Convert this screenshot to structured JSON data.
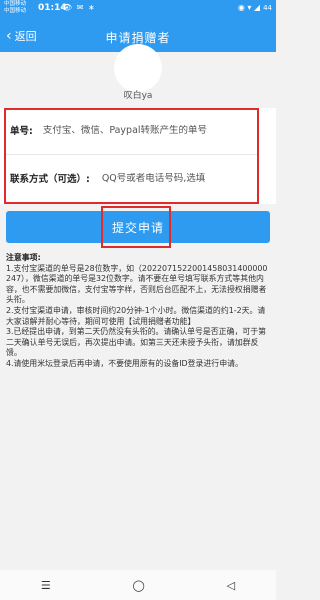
{
  "status_bar": {
    "carrier_1": "中国移动",
    "carrier_2": "中国移动",
    "time": "01:14",
    "icons_left": "👁 ✉ ∗",
    "icons_right": "◉ ▾ ◢",
    "battery": "44"
  },
  "header": {
    "back_label": "返回",
    "title": "申请捐赠者"
  },
  "user": {
    "name": "叹白ya"
  },
  "form": {
    "order_label": "单号:",
    "order_placeholder": "支付宝、微信、Paypal转账产生的单号",
    "contact_label": "联系方式（可选）:",
    "contact_placeholder": "QQ号或者电话号码,选填"
  },
  "submit_label": "提交申请",
  "notes": {
    "title": "注意事项:",
    "items": [
      "1.支付宝渠道的单号是28位数字，如（2022071522001458031400000247），微信渠道的单号是32位数字。请不要在单号填写联系方式等其他内容，也不需要加微信，支付宝等字样，否则后台匹配不上，无法授权捐赠者头衔。",
      "2.支付宝渠道申请，审核时间约20分钟-1个小时。微信渠道的约1-2天。请大家谅解并耐心等待，期间可使用【试用捐赠者功能】",
      "3.已经提出申请，到第二天仍然没有头衔的。请确认单号是否正确，可于第二天确认单号无误后，再次提出申请。如第三天还未授予头衔，请加群反馈。",
      "4.请使用米坛登录后再申请，不要使用原有的设备ID登录进行申请。"
    ]
  },
  "nav": {
    "menu": "☰",
    "home": "◯",
    "back": "◁"
  }
}
